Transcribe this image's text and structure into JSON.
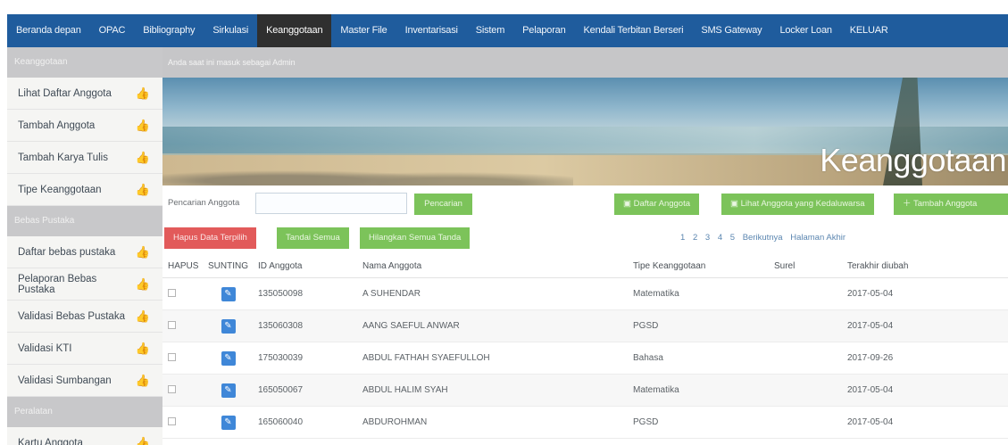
{
  "nav": {
    "items": [
      "Beranda depan",
      "OPAC",
      "Bibliography",
      "Sirkulasi",
      "Keanggotaan",
      "Master File",
      "Inventarisasi",
      "Sistem",
      "Pelaporan",
      "Kendali Terbitan Berseri",
      "SMS Gateway",
      "Locker Loan",
      "KELUAR"
    ],
    "active": "Keanggotaan"
  },
  "sidebar": {
    "sections": [
      {
        "title": "Keanggotaan",
        "items": [
          "Lihat Daftar Anggota",
          "Tambah Anggota",
          "Tambah Karya Tulis",
          "Tipe Keanggotaan"
        ]
      },
      {
        "title": "Bebas Pustaka",
        "items": [
          "Daftar bebas pustaka",
          "Pelaporan Bebas Pustaka",
          "Validasi Bebas Pustaka",
          "Validasi KTI",
          "Validasi Sumbangan"
        ]
      },
      {
        "title": "Peralatan",
        "items": [
          "Kartu Anggota"
        ]
      }
    ]
  },
  "info_bar": "Anda saat ini masuk sebagai Admin",
  "banner_title": "Keanggotaan",
  "search": {
    "label": "Pencarian Anggota",
    "value": "",
    "button": "Pencarian"
  },
  "actions": {
    "list_members": "Daftar Anggota",
    "overdue_members": "Lihat Anggota yang Kedaluwarsa",
    "add_member": "Tambah Anggota",
    "delete_selected": "Hapus Data Terpilih",
    "mark_all": "Tandai Semua",
    "unmark_all": "Hilangkan Semua Tanda"
  },
  "pagination": [
    "1",
    "2",
    "3",
    "4",
    "5",
    "Berikutnya",
    "Halaman Akhir"
  ],
  "table": {
    "headers": [
      "HAPUS",
      "SUNTING",
      "ID Anggota",
      "Nama Anggota",
      "Tipe Keanggotaan",
      "Surel",
      "Terakhir diubah"
    ],
    "rows": [
      {
        "id": "135050098",
        "name": "A SUHENDAR",
        "type": "Matematika",
        "email": "",
        "updated": "2017-05-04"
      },
      {
        "id": "135060308",
        "name": "AANG SAEFUL ANWAR",
        "type": "PGSD",
        "email": "",
        "updated": "2017-05-04"
      },
      {
        "id": "175030039",
        "name": "ABDUL FATHAH SYAEFULLOH",
        "type": "Bahasa",
        "email": "",
        "updated": "2017-09-26"
      },
      {
        "id": "165050067",
        "name": "ABDUL HALIM SYAH",
        "type": "Matematika",
        "email": "",
        "updated": "2017-05-04"
      },
      {
        "id": "165060040",
        "name": "ABDUROHMAN",
        "type": "PGSD",
        "email": "",
        "updated": "2017-05-04"
      }
    ]
  }
}
